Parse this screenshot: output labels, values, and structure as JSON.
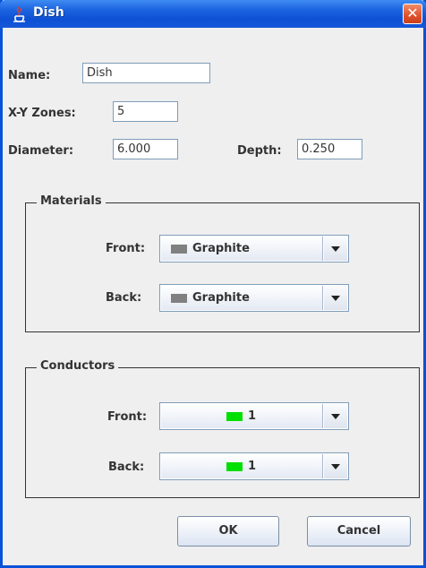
{
  "window": {
    "title": "Dish",
    "close_glyph": "✕"
  },
  "form": {
    "name_label": "Name:",
    "name_value": "Dish",
    "zones_label": "X-Y Zones:",
    "zones_value": "5",
    "diameter_label": "Diameter:",
    "diameter_value": "6.000",
    "depth_label": "Depth:",
    "depth_value": "0.250"
  },
  "materials": {
    "title": "Materials",
    "front_label": "Front:",
    "front_value": "Graphite",
    "front_color": "#808080",
    "back_label": "Back:",
    "back_value": "Graphite",
    "back_color": "#808080"
  },
  "conductors": {
    "title": "Conductors",
    "front_label": "Front:",
    "front_value": "1",
    "front_color": "#00e000",
    "back_label": "Back:",
    "back_value": "1",
    "back_color": "#00e000"
  },
  "buttons": {
    "ok": "OK",
    "cancel": "Cancel"
  },
  "icons": {
    "title_icon": "java-cup-icon",
    "dropdown": "chevron-down-icon"
  }
}
